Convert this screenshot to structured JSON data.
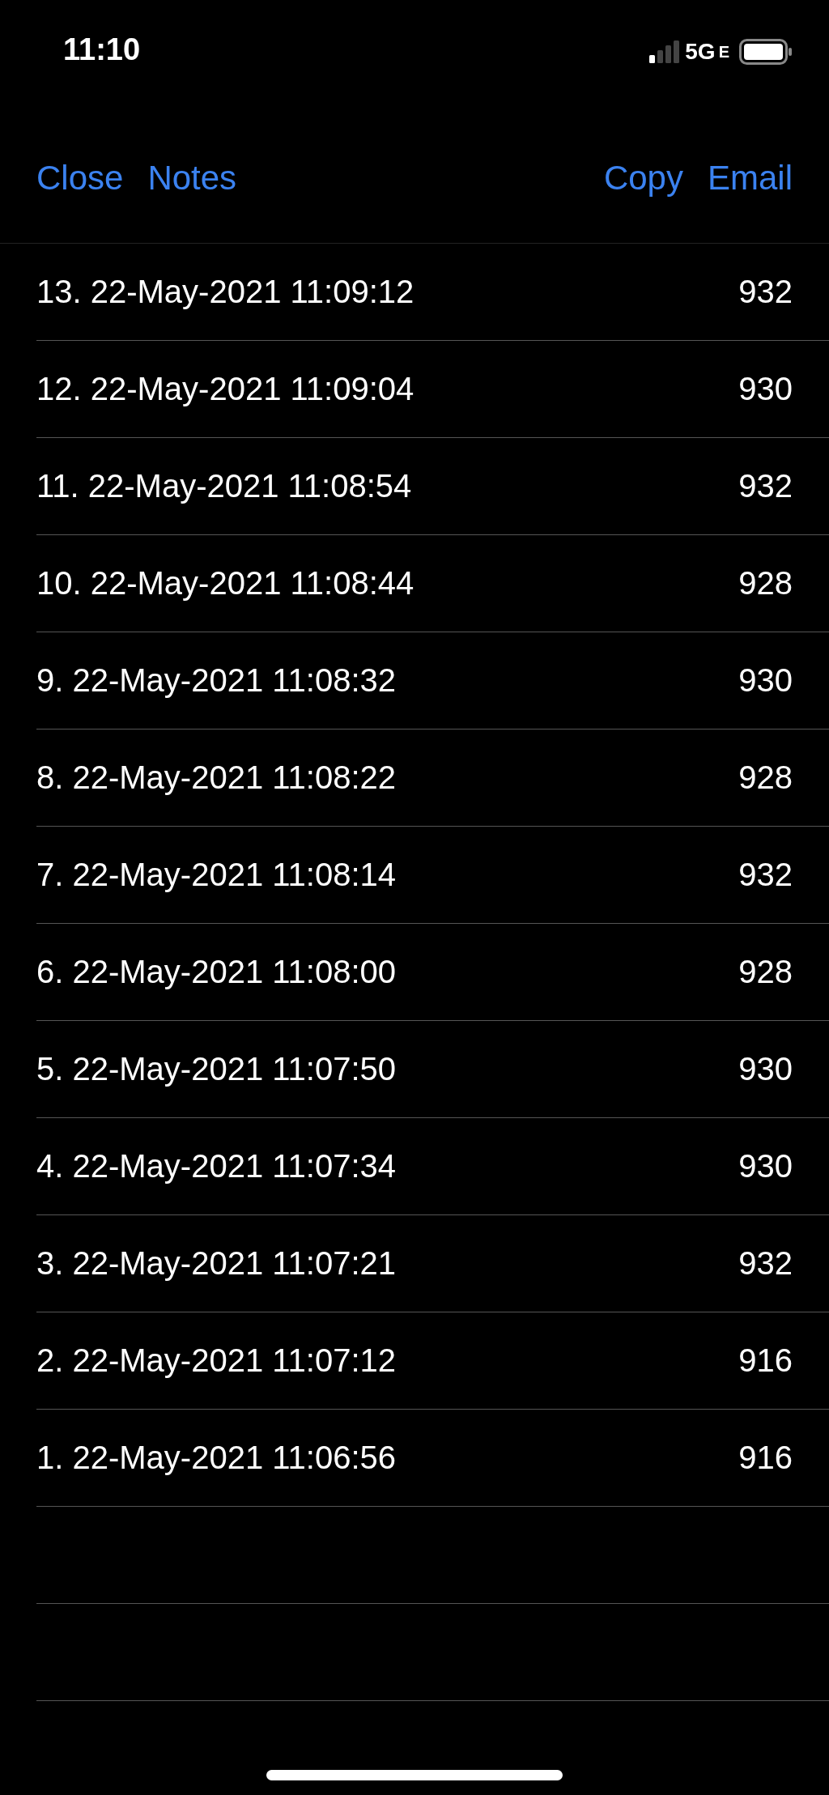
{
  "status_bar": {
    "time": "11:10",
    "network": "5G",
    "network_suffix": "E"
  },
  "nav": {
    "left_buttons": [
      "Close",
      "Notes"
    ],
    "right_buttons": [
      "Copy",
      "Email"
    ]
  },
  "rows": [
    {
      "label": "13. 22-May-2021 11:09:12",
      "value": "932"
    },
    {
      "label": "12. 22-May-2021 11:09:04",
      "value": "930"
    },
    {
      "label": "11. 22-May-2021 11:08:54",
      "value": "932"
    },
    {
      "label": "10. 22-May-2021 11:08:44",
      "value": "928"
    },
    {
      "label": "9. 22-May-2021 11:08:32",
      "value": "930"
    },
    {
      "label": "8. 22-May-2021 11:08:22",
      "value": "928"
    },
    {
      "label": "7. 22-May-2021 11:08:14",
      "value": "932"
    },
    {
      "label": "6. 22-May-2021 11:08:00",
      "value": "928"
    },
    {
      "label": "5. 22-May-2021 11:07:50",
      "value": "930"
    },
    {
      "label": "4. 22-May-2021 11:07:34",
      "value": "930"
    },
    {
      "label": "3. 22-May-2021 11:07:21",
      "value": "932"
    },
    {
      "label": "2. 22-May-2021 11:07:12",
      "value": "916"
    },
    {
      "label": "1. 22-May-2021 11:06:56",
      "value": "916"
    }
  ]
}
